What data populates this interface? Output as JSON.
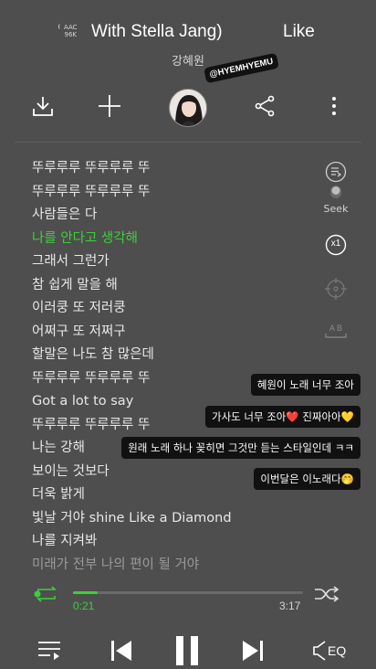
{
  "header": {
    "quality_badge_line1": "AAC",
    "quality_badge_line2": "96K",
    "title": "With Stella Jang)",
    "title_next": "Like",
    "artist": "강혜원",
    "sticker": "@HYEMHYEMU"
  },
  "toolbar": {
    "download_icon": "download-icon",
    "add_icon": "plus-icon",
    "share_icon": "share-icon",
    "more_icon": "more-vertical-icon"
  },
  "lyrics": [
    "뚜루루루 뚜루루루 뚜",
    "뚜루루루 뚜루루루 뚜",
    "사람들은 다",
    "나를 안다고 생각해",
    "그래서 그런가",
    "참 쉽게 말을 해",
    "이러쿵 또 저러쿵",
    "어쩌구 또 저쩌구",
    "할말은 나도 참 많은데",
    "뚜루루루 뚜루루루 뚜",
    "Got a lot to say",
    "뚜루루루 뚜루루루 뚜",
    "나는 강해",
    "보이는 것보다",
    "더욱 밝게",
    "빛날 거야 shine Like a Diamond",
    "나를 지켜봐",
    "미래가 전부 나의 편이 될 거야"
  ],
  "active_lyric_index": 3,
  "side": {
    "seek_label": "Seek",
    "speed_label": "x1",
    "ab_label": "A B"
  },
  "chats": [
    "혜원이 노래 너무 조아",
    "가사도 너무 조아❤️ 진짜아아💛",
    "원래 노래 하나 꽂히면 그것만 듣는 스타일인데 ㅋㅋ",
    "이번달은 이노래다🤭"
  ],
  "player": {
    "elapsed": "0:21",
    "duration": "3:17",
    "progress_fraction": 0.107,
    "eq_label": "EQ"
  },
  "colors": {
    "accent": "#3ad13a",
    "background": "#4e4e4e"
  }
}
